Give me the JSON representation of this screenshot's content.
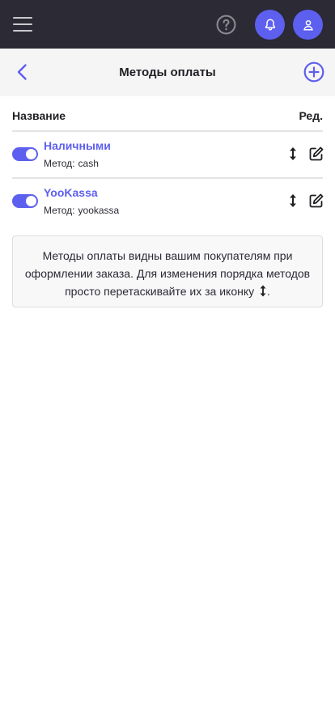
{
  "topbar": {
    "menu_icon": "hamburger-menu-icon",
    "help_icon": "question-circle-icon",
    "notifications_icon": "bell-icon",
    "profile_icon": "user-icon",
    "colors": {
      "background": "#2b2a35",
      "accent": "#5d5fef"
    }
  },
  "header": {
    "title": "Методы оплаты",
    "back_icon": "chevron-left-icon",
    "add_icon": "plus-circle-icon"
  },
  "table": {
    "columns": {
      "name": "Название",
      "edit": "Ред."
    },
    "rows": [
      {
        "title": "Наличными",
        "method_label": "Метод:",
        "method_value": "cash",
        "enabled": true
      },
      {
        "title": "YooKassa",
        "method_label": "Метод:",
        "method_value": "yookassa",
        "enabled": true
      }
    ]
  },
  "info": {
    "text": "Методы оплаты видны вашим покупателям при оформлении заказа. Для изменения порядка методов просто перетаскивайте их за иконку",
    "icon": "sort-vertical-icon",
    "end": "."
  }
}
